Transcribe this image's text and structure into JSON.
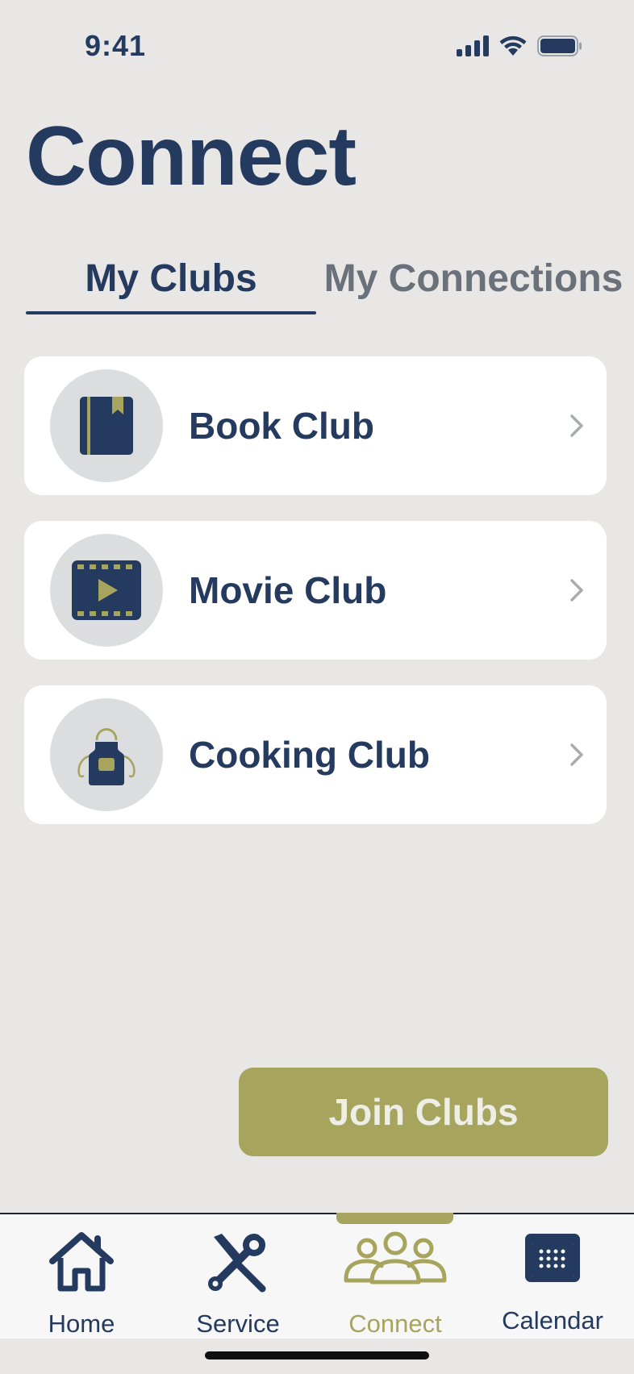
{
  "status_bar": {
    "time": "9:41",
    "icons": [
      "signal-icon",
      "wifi-icon",
      "battery-icon"
    ]
  },
  "page": {
    "title": "Connect"
  },
  "tabs": [
    {
      "label": "My Clubs",
      "selected": true
    },
    {
      "label": "My Connections",
      "selected": false
    }
  ],
  "clubs": [
    {
      "name": "Book Club",
      "icon": "book-icon"
    },
    {
      "name": "Movie Club",
      "icon": "film-icon"
    },
    {
      "name": "Cooking Club",
      "icon": "apron-icon"
    }
  ],
  "join_button": {
    "label": "Join Clubs"
  },
  "nav": [
    {
      "label": "Home",
      "icon": "home-icon",
      "active": false
    },
    {
      "label": "Service",
      "icon": "tools-icon",
      "active": false
    },
    {
      "label": "Connect",
      "icon": "people-icon",
      "active": true
    },
    {
      "label": "Calendar",
      "icon": "calendar-icon",
      "active": false
    }
  ],
  "colors": {
    "primary_navy": "#243a5e",
    "accent_olive": "#a7a45e",
    "background": "#e8e7e6",
    "card": "#ffffff",
    "inactive_tab": "#6b717a"
  }
}
